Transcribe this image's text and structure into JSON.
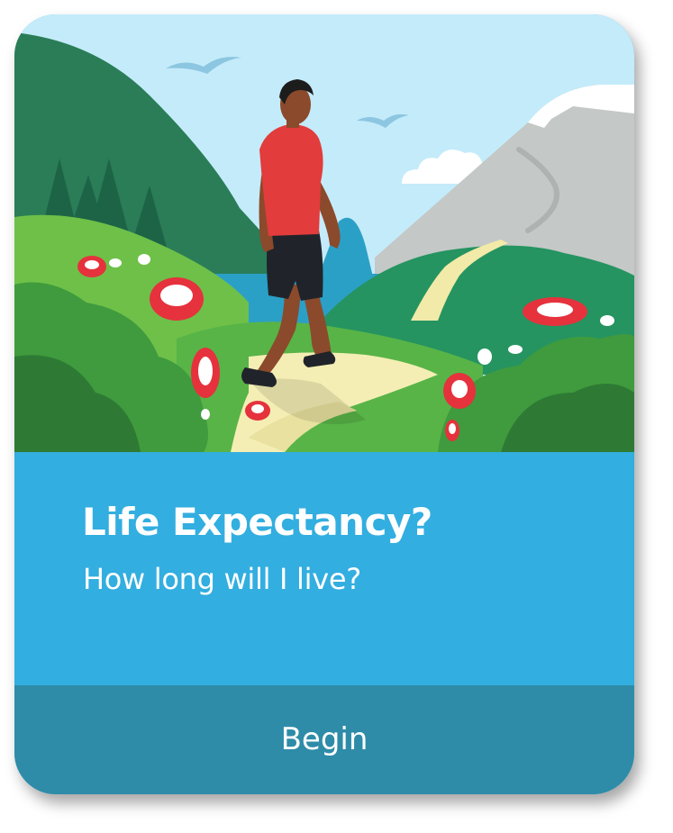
{
  "card": {
    "illustration_name": "person-walking-landscape",
    "title": "Life Expectancy?",
    "subtitle": "How long will I live?",
    "begin_label": "Begin"
  },
  "colors": {
    "sky": "#c4ebfa",
    "info_panel": "#33aee0",
    "button": "#2e8ca8",
    "text": "#ffffff",
    "shirt": "#e23c3c",
    "flower_red": "#e5323d"
  }
}
